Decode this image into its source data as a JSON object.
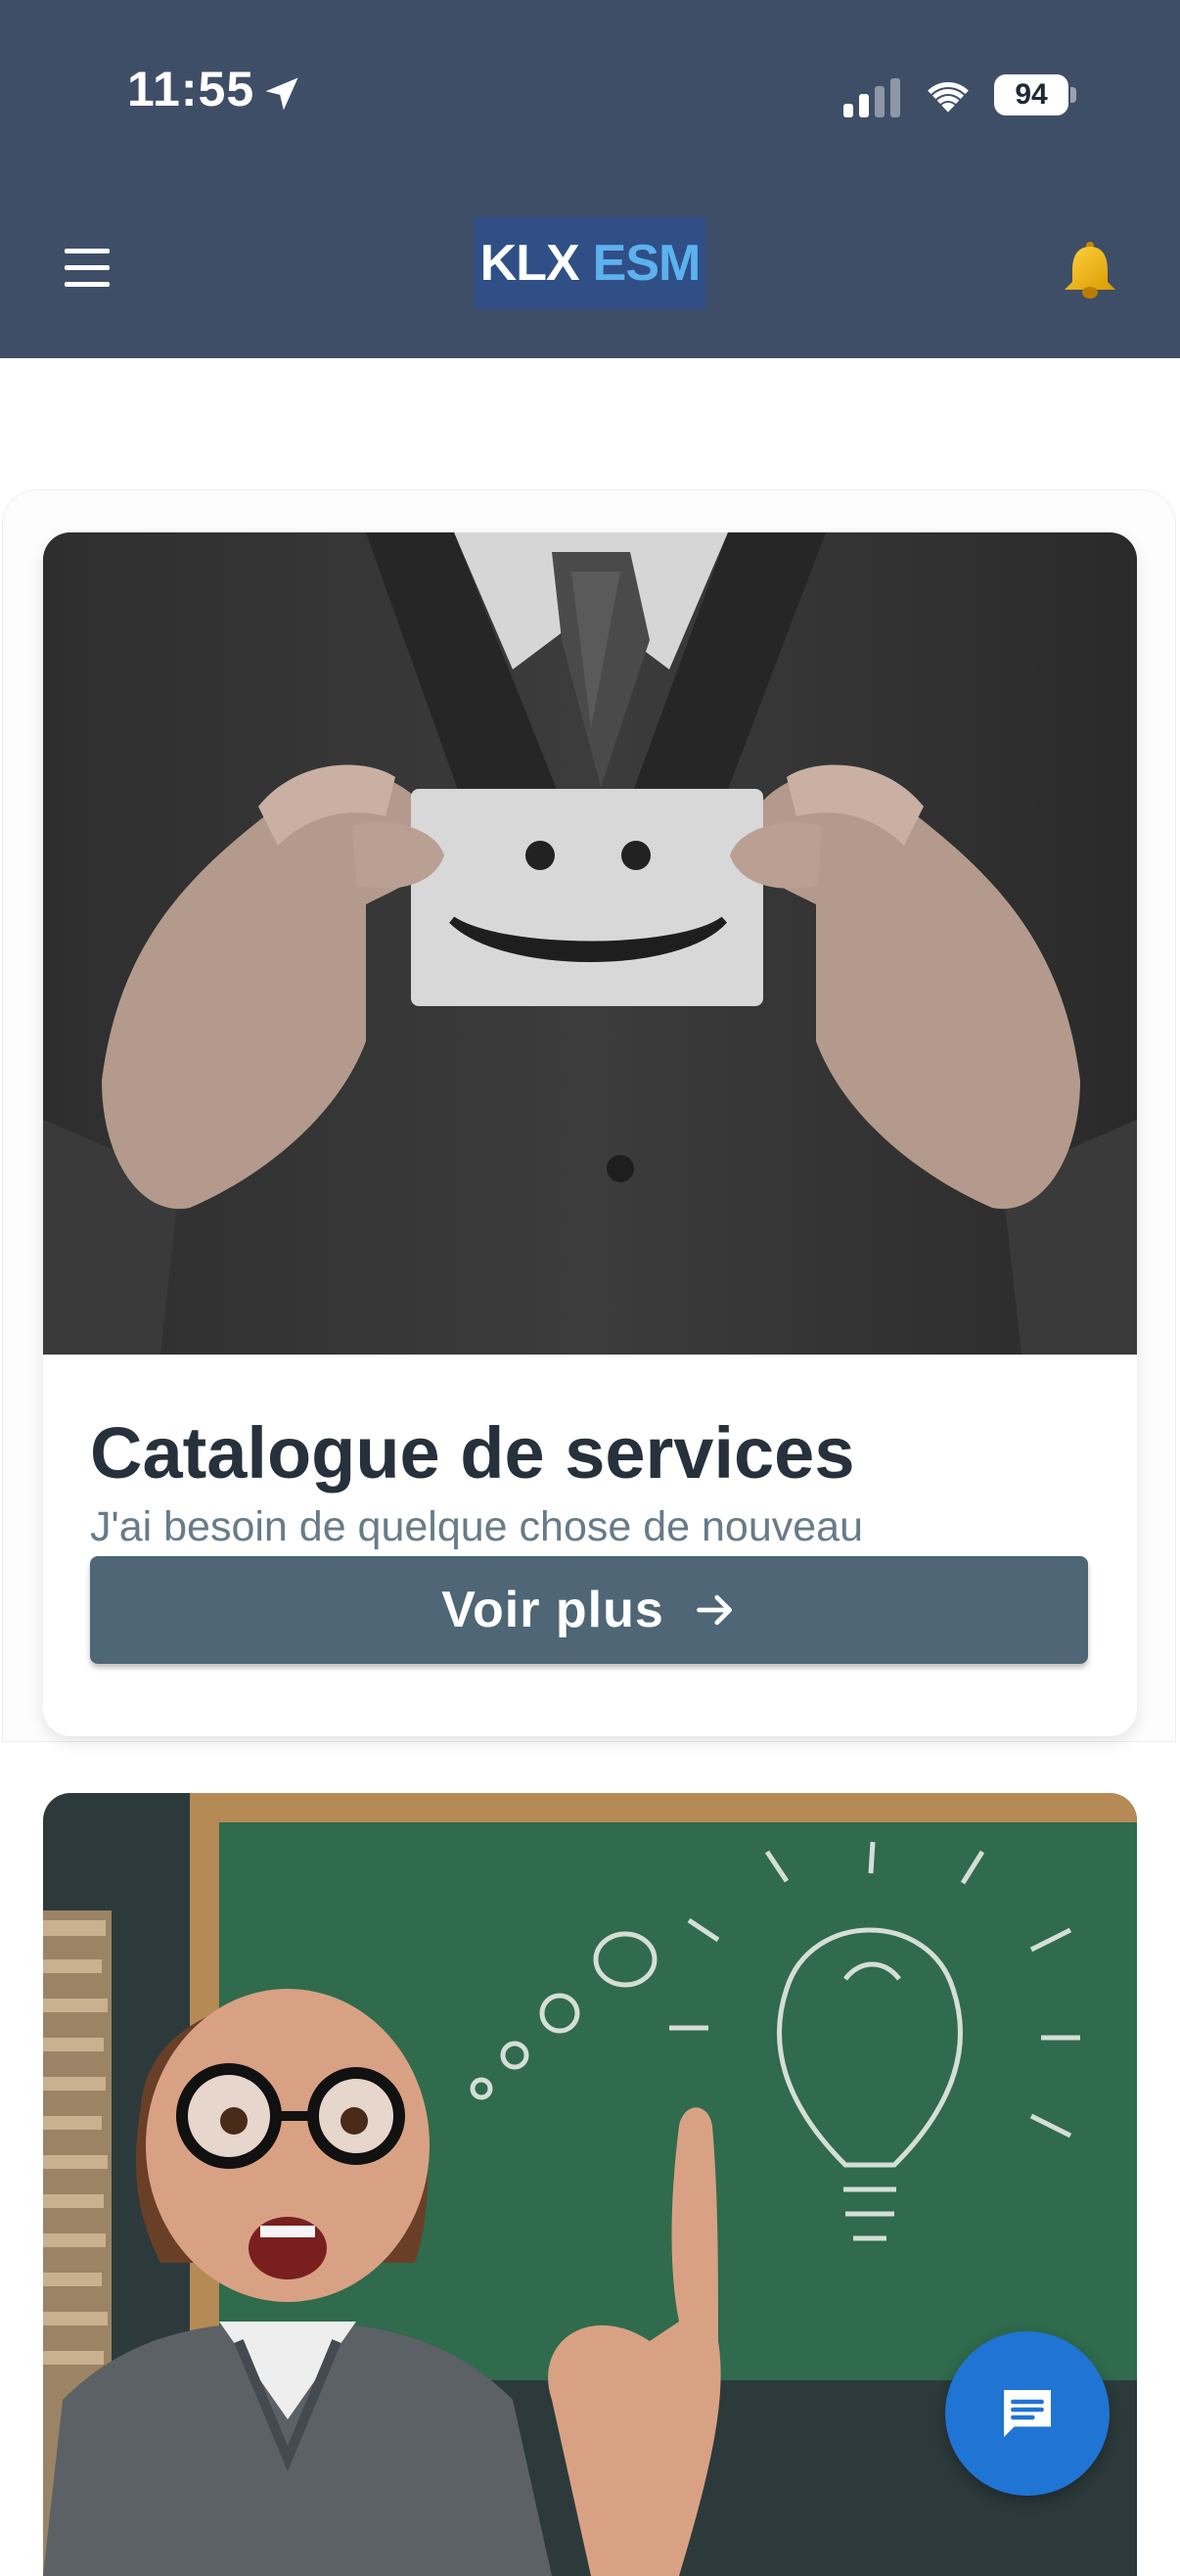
{
  "status_bar": {
    "time": "11:55",
    "battery": "94"
  },
  "header": {
    "logo_part1": "KLX",
    "logo_part2": "ESM"
  },
  "cards": [
    {
      "title": "Catalogue de services",
      "subtitle": "J'ai besoin de quelque chose de nouveau",
      "button_label": "Voir plus"
    }
  ],
  "colors": {
    "header_bg": "#3f4e67",
    "button_bg": "#4e6675",
    "fab_bg": "#1f74d4",
    "logo_accent": "#5db1ee"
  },
  "icons": {
    "menu": "menu-icon",
    "notifications": "bell-icon",
    "chat": "chat-icon",
    "button_arrow": "arrow-right-icon"
  }
}
